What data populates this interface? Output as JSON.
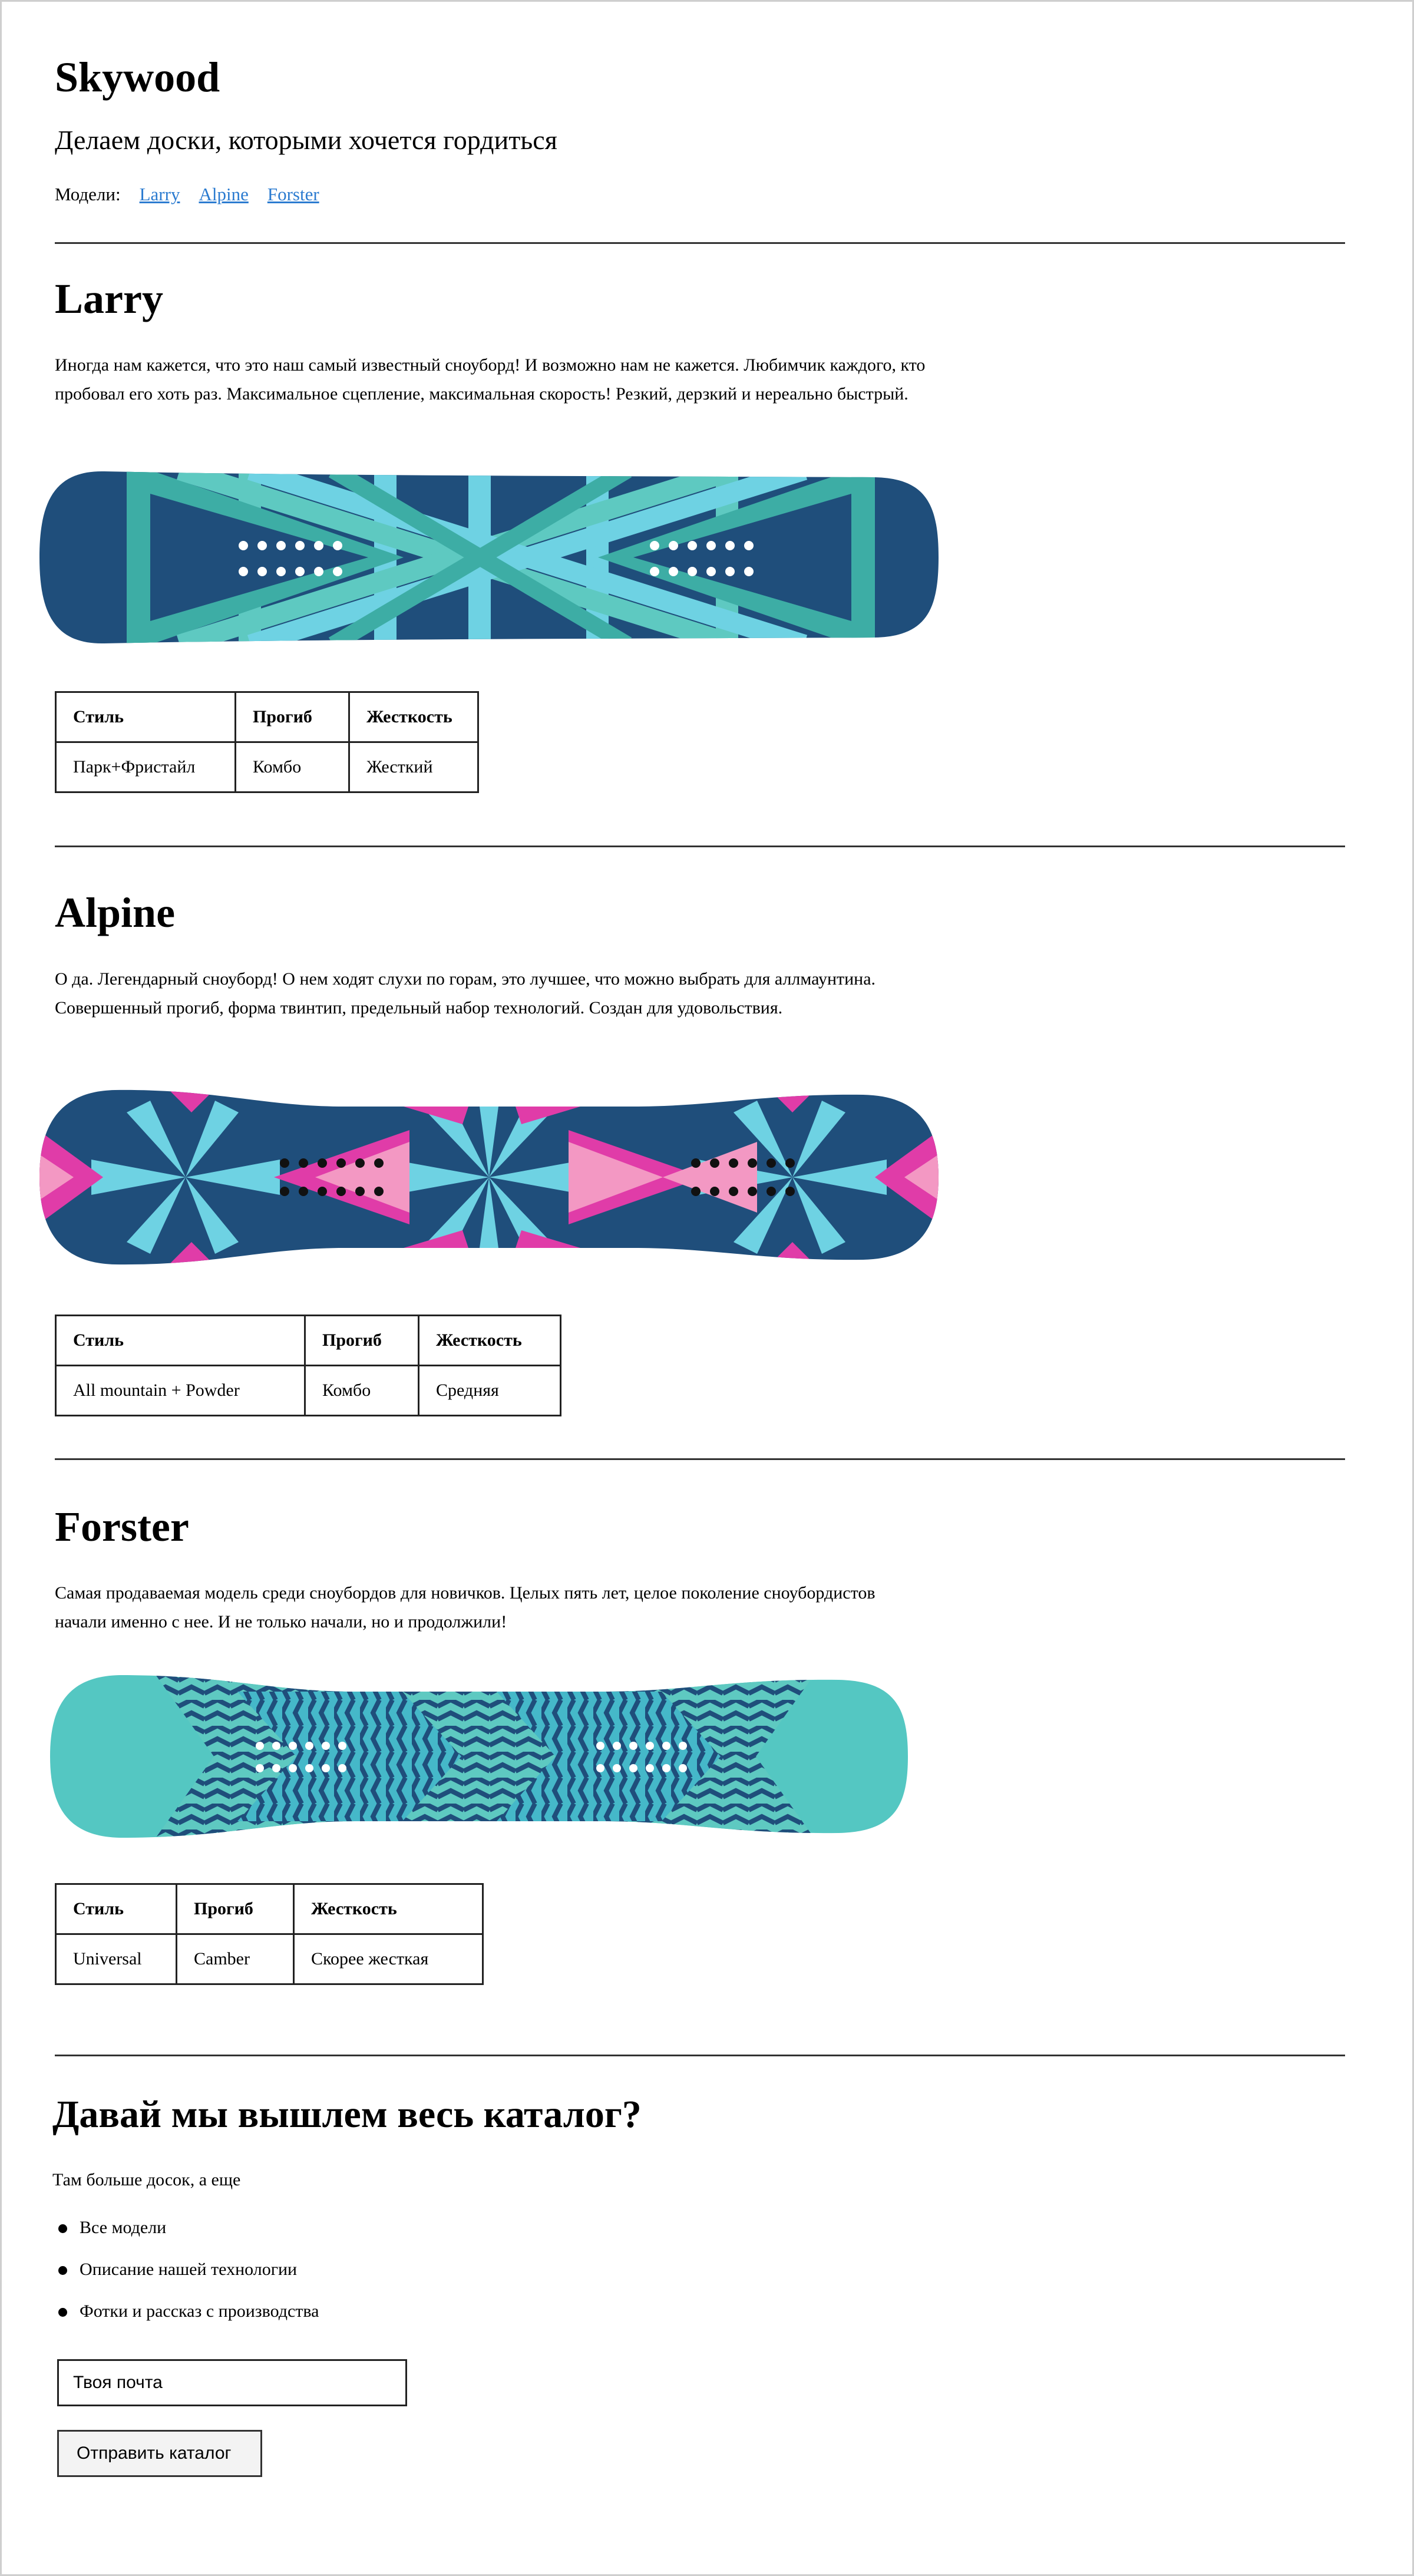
{
  "site": {
    "title": "Skywood",
    "tagline": "Делаем доски, которыми хочется гордиться",
    "models_label": "Модели:",
    "nav": [
      "Larry",
      "Alpine",
      "Forster"
    ]
  },
  "colors": {
    "link": "#2b7bd0",
    "board_navy": "#1f4e7b",
    "teal": "#3dada5",
    "light_teal": "#5ec9c1",
    "sky_blue": "#6ed2e3",
    "magenta": "#e03ca8",
    "pink": "#f398c3"
  },
  "table_headers": {
    "style": "Стиль",
    "flex": "Прогиб",
    "stiffness": "Жесткость"
  },
  "models": [
    {
      "name": "Larry",
      "description": "Иногда нам кажется, что это наш самый известный сноуборд! И возможно нам не кажется. Любимчик каждого, кто пробовал его хоть раз. Максимальное сцепление, максимальная скорость! Резкий, дерзкий и нереально быстрый.",
      "board_icon": "larry-board-graphic",
      "style": "Парк+Фристайл",
      "flex": "Комбо",
      "stiffness": "Жесткий"
    },
    {
      "name": "Alpine",
      "description": "О да. Легендарный сноуборд! О нем ходят слухи по горам, это лучшее, что можно выбрать для аллмаунтина. Совершенный прогиб, форма твинтип, предельный набор технологий. Создан для удовольствия.",
      "board_icon": "alpine-board-graphic",
      "style": "All mountain + Powder",
      "flex": "Комбо",
      "stiffness": "Средняя"
    },
    {
      "name": "Forster",
      "description": "Самая продаваемая модель среди сноубордов для новичков. Целых пять лет, целое поколение сноубордистов начали именно с нее. И не только начали, но и продолжили!",
      "board_icon": "forster-board-graphic",
      "style": "Universal",
      "flex": "Camber",
      "stiffness": "Скорее жесткая"
    }
  ],
  "catalog": {
    "title": "Давай мы вышлем весь каталог?",
    "intro": "Там больше досок, а еще",
    "items": [
      "Все модели",
      "Описание нашей технологии",
      "Фотки и рассказ с производства"
    ],
    "email_placeholder": "Твоя почта",
    "submit_label": "Отправить каталог"
  }
}
